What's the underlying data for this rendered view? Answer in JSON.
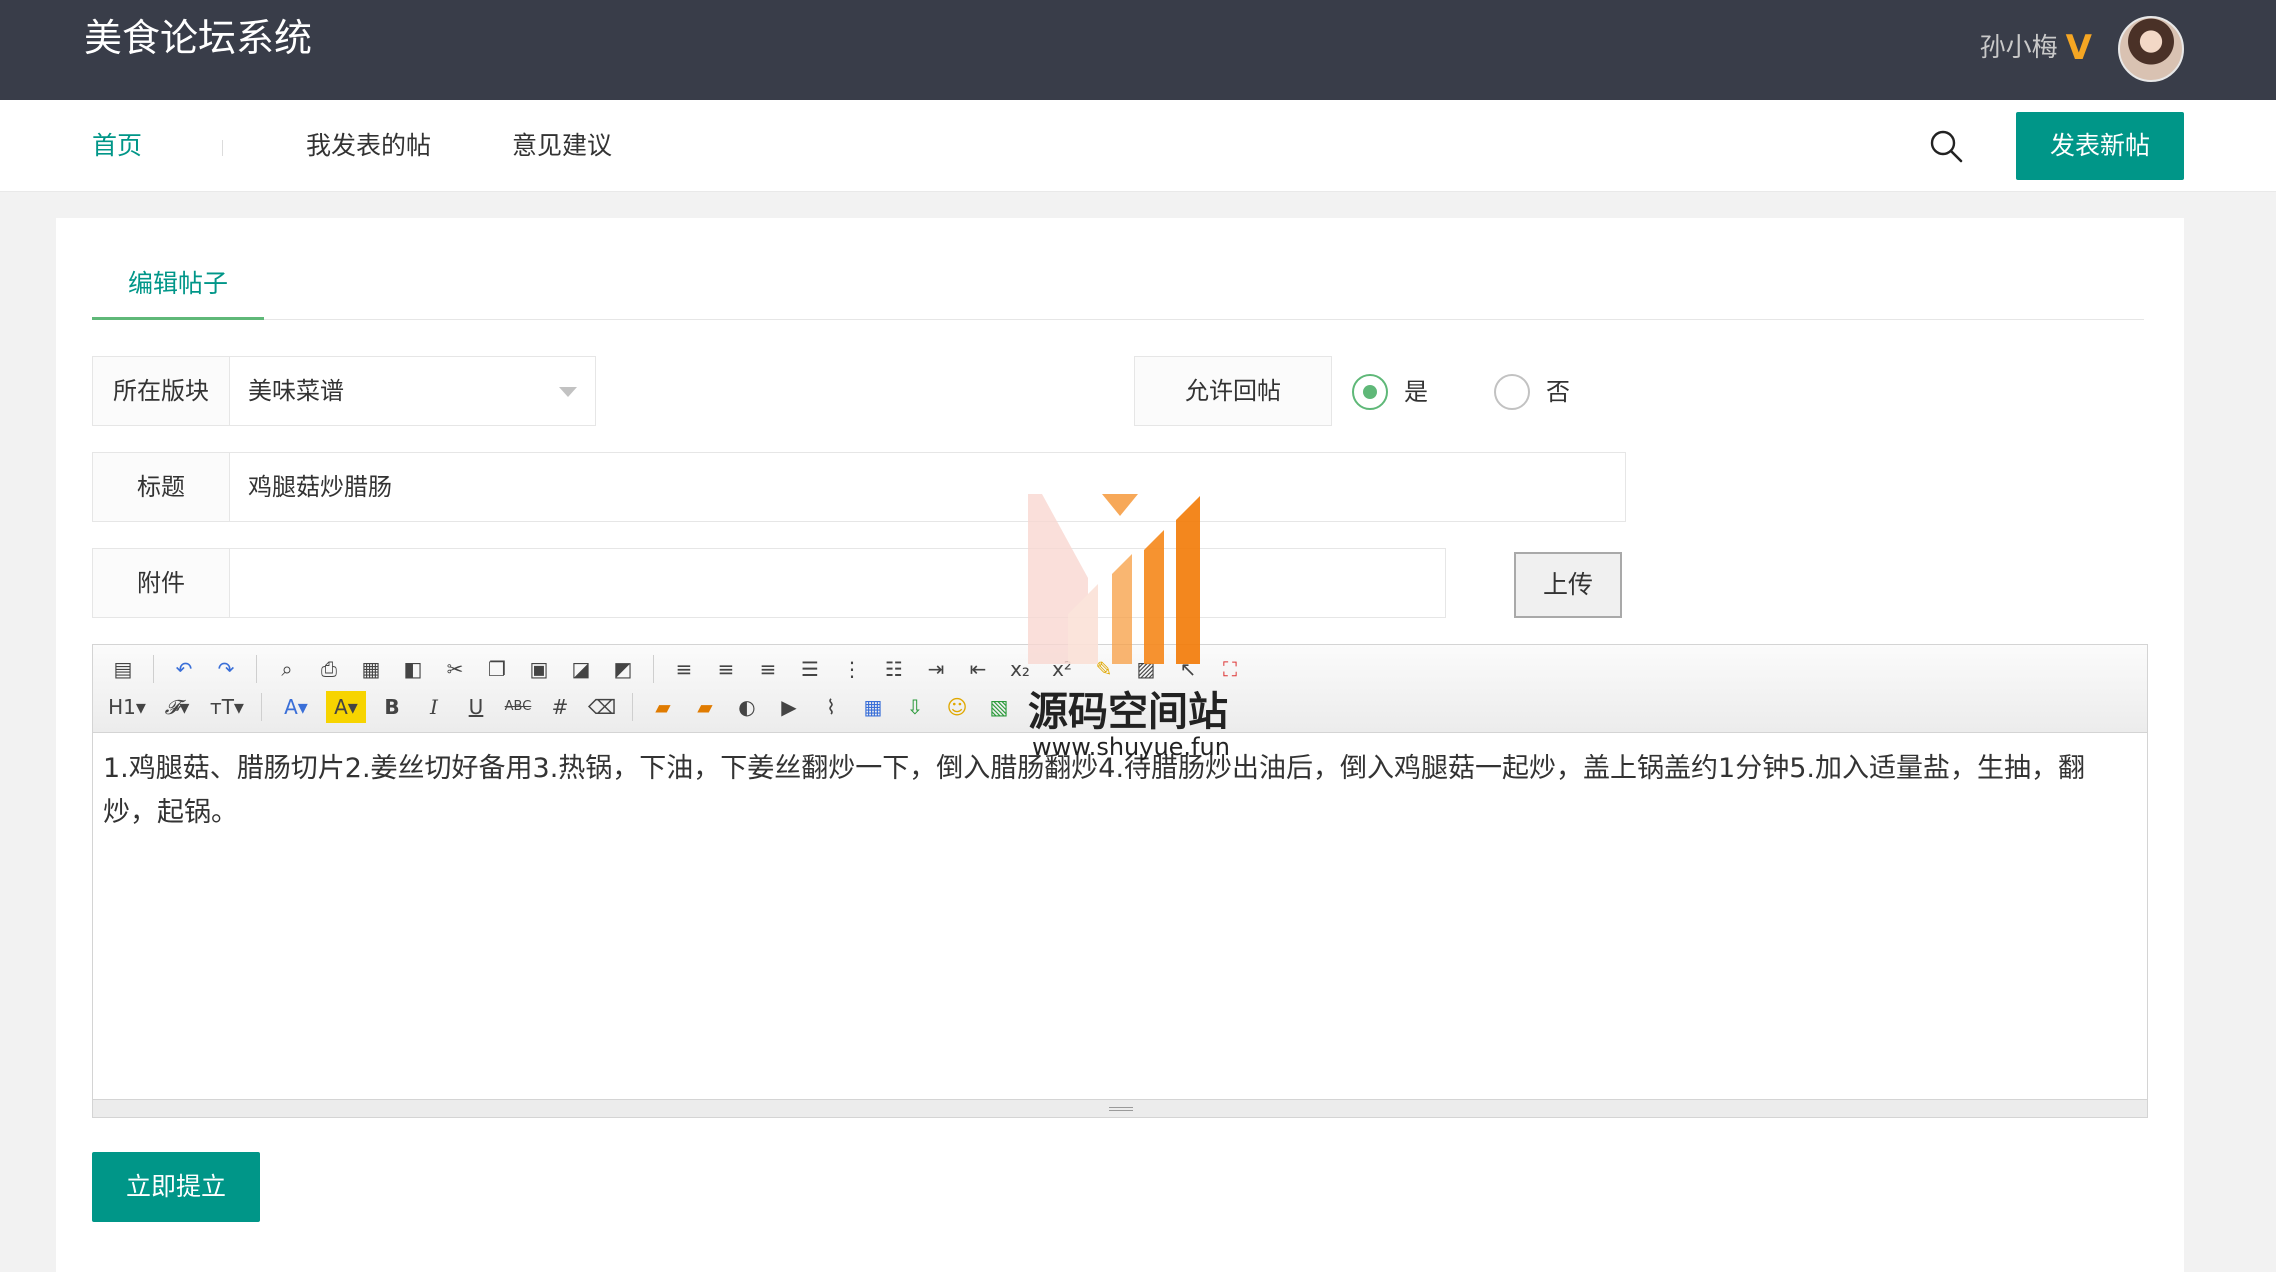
{
  "header": {
    "logo": "美食论坛系统",
    "username": "孙小梅",
    "vip_badge": "V"
  },
  "nav": {
    "items": [
      {
        "label": "首页",
        "active": true
      },
      {
        "label": "我发表的帖"
      },
      {
        "label": "意见建议"
      }
    ],
    "publish_label": "发表新帖"
  },
  "tab": {
    "label": "编辑帖子"
  },
  "form": {
    "section_label": "所在版块",
    "section_value": "美味菜谱",
    "reply_label": "允许回帖",
    "reply_options": [
      {
        "label": "是",
        "checked": true
      },
      {
        "label": "否",
        "checked": false
      }
    ],
    "title_label": "标题",
    "title_value": "鸡腿菇炒腊肠",
    "attachment_label": "附件",
    "attachment_value": "",
    "upload_label": "上传",
    "content": "1.鸡腿菇、腊肠切片2.姜丝切好备用3.热锅，下油，下姜丝翻炒一下，倒入腊肠翻炒4.待腊肠炒出油后，倒入鸡腿菇一起炒，盖上锅盖约1分钟5.加入适量盐，生抽，翻炒，起锅。",
    "submit_label": "立即提立"
  },
  "watermark": {
    "title": "源码空间站",
    "url": "www.shuyue.fun"
  },
  "colors": {
    "header_bg": "#393d49",
    "accent": "#009688",
    "radio_checked": "#5fb878",
    "vip": "#f5a623"
  }
}
